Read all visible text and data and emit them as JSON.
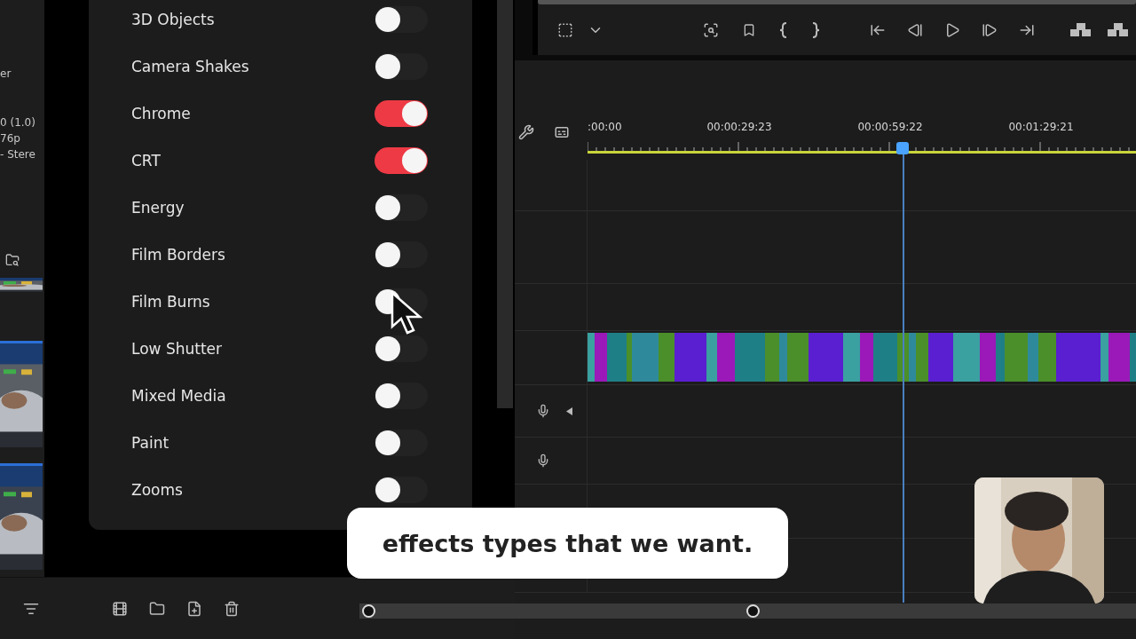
{
  "project_panel": {
    "lines": [
      "er",
      "0 (1.0)",
      "76p",
      "- Stere"
    ]
  },
  "effects_panel": {
    "items": [
      {
        "label": "3D Objects",
        "on": false
      },
      {
        "label": "Camera Shakes",
        "on": false
      },
      {
        "label": "Chrome",
        "on": true
      },
      {
        "label": "CRT",
        "on": true
      },
      {
        "label": "Energy",
        "on": false
      },
      {
        "label": "Film Borders",
        "on": false
      },
      {
        "label": "Film Burns",
        "on": false
      },
      {
        "label": "Low Shutter",
        "on": false
      },
      {
        "label": "Mixed Media",
        "on": false
      },
      {
        "label": "Paint",
        "on": false
      },
      {
        "label": "Zooms",
        "on": false
      }
    ]
  },
  "timeline": {
    "timecodes": [
      ":00:00",
      "00:00:29:23",
      "00:00:59:22",
      "00:01:29:21"
    ]
  },
  "caption": {
    "text": "effects types that we want."
  }
}
